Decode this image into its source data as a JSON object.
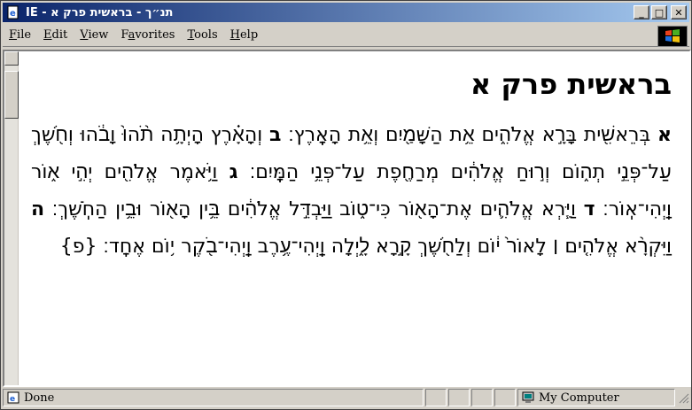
{
  "window": {
    "title": "IE - תנ״ך - בראשית פרק א",
    "controls": {
      "minimize": "_",
      "maximize": "□",
      "close": "✕"
    }
  },
  "menu": {
    "items": [
      {
        "underline": "F",
        "rest": "ile"
      },
      {
        "underline": "E",
        "rest": "dit"
      },
      {
        "underline": "V",
        "rest": "iew"
      },
      {
        "underline": "a",
        "prefix": "F",
        "rest": "vorites"
      },
      {
        "underline": "T",
        "rest": "ools"
      },
      {
        "underline": "H",
        "rest": "elp"
      }
    ]
  },
  "document": {
    "heading": "בראשית פרק א",
    "verses": [
      {
        "num": "א",
        "text": "בְּרֵאשִׁ֖ית בָּרָ֣א אֱלֹהִ֑ים אֵ֥ת הַשָּׁמַ֖יִם וְאֵ֥ת הָאָֽרֶץ׃"
      },
      {
        "num": "ב",
        "text": "וְהָאָ֗רֶץ הָיְתָ֥ה תֹ֨הוּ֙ וָבֹ֔הוּ וְחֹ֖שֶׁךְ עַל־פְּנֵ֣י תְה֑וֹם וְר֣וּחַ אֱלֹהִ֔ים מְרַחֶ֖פֶת עַל־פְּנֵ֥י הַמָּֽיִם׃"
      },
      {
        "num": "ג",
        "text": "וַיֹּ֥אמֶר אֱלֹהִ֖ים יְהִ֣י א֑וֹר וַֽיְהִי־אֽוֹר׃"
      },
      {
        "num": "ד",
        "text": "וַיַּ֧רְא אֱלֹהִ֛ים אֶת־הָא֖וֹר כִּי־ט֑וֹב וַיַּבְדֵּ֣ל אֱלֹהִ֔ים בֵּ֥ין הָא֖וֹר וּבֵ֥ין הַחֹֽשֶׁךְ׃"
      },
      {
        "num": "ה",
        "text": "וַיִּקְרָ֨א אֱלֹהִ֤ים ׀ לָאוֹר֙ י֔וֹם וְלַחֹ֖שֶׁךְ קָ֣רָא לָ֑יְלָה וַֽיְהִי־עֶ֥רֶב וַֽיְהִי־בֹ֖קֶר י֥וֹם אֶחָֽד׃ {פ}"
      }
    ]
  },
  "status": {
    "text": "Done",
    "zone": "My Computer"
  },
  "colors": {
    "title_start": "#0a246a",
    "title_end": "#a6caf0",
    "chrome": "#d4d0c8"
  }
}
